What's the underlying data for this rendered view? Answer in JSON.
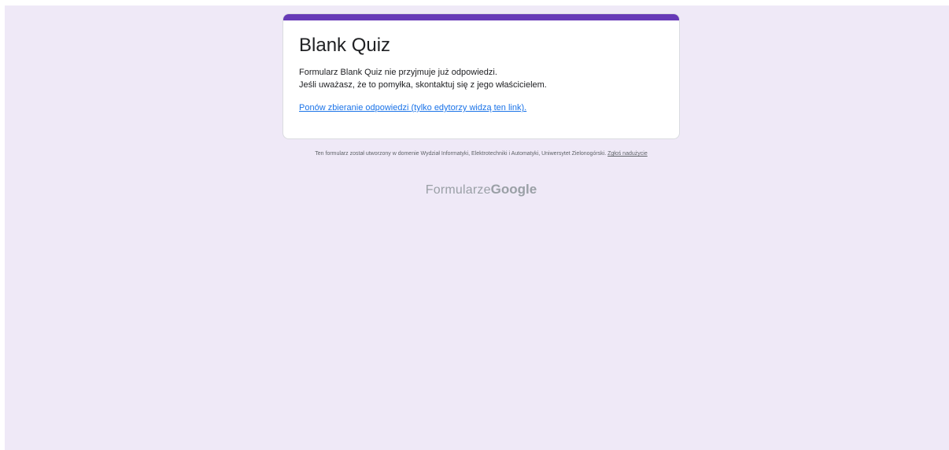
{
  "card": {
    "title": "Blank Quiz",
    "message_line1": "Formularz Blank Quiz nie przyjmuje już odpowiedzi.",
    "message_line2": "Jeśli uważasz, że to pomyłka, skontaktuj się z jego właścicielem.",
    "resume_link": "Ponów zbieranie odpowiedzi (tylko edytorzy widzą ten link).",
    "accent_color": "#673ab7"
  },
  "footer": {
    "note": "Ten formularz został utworzony w domenie Wydział Informatyki, Elektrotechniki i Automatyki, Uniwersytet Zielonogórski.",
    "abuse_link": "Zgłoś nadużycie"
  },
  "brand": {
    "forms": "Formularze",
    "google": "Google"
  },
  "colors": {
    "background": "#efe9f7",
    "link": "#1a73e8"
  }
}
